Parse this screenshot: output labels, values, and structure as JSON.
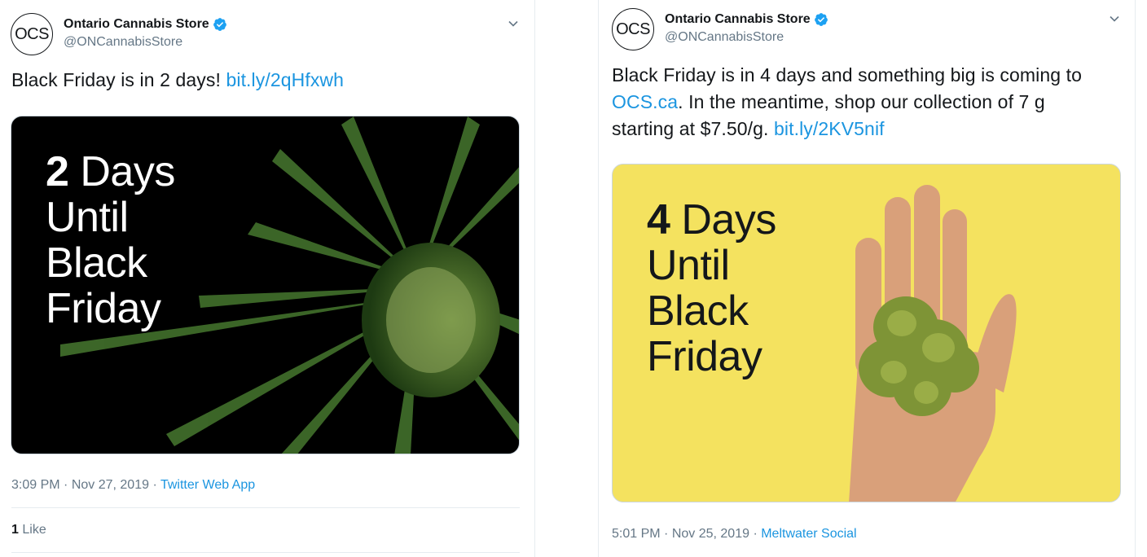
{
  "tweets": [
    {
      "account_name": "Ontario Cannabis Store",
      "handle": "@ONCannabisStore",
      "avatar_text": "OCS",
      "text_plain": "Black Friday is in 2 days! ",
      "link": "bit.ly/2qHfxwh",
      "media": {
        "title_number": "2",
        "title_lines": [
          "Days",
          "Until",
          "Black",
          "Friday"
        ],
        "background": "#000000"
      },
      "time": "3:09 PM",
      "date": "Nov 27, 2019",
      "source": "Twitter Web App",
      "likes_count": "1",
      "likes_label": "Like"
    },
    {
      "account_name": "Ontario Cannabis Store",
      "handle": "@ONCannabisStore",
      "avatar_text": "OCS",
      "text_part1": "Black Friday is in 4 days and something big is coming to",
      "text_link1": "OCS.ca",
      "text_part2": ". In the meantime, shop our collection of 7 g",
      "text_part3": "starting at $7.50/g. ",
      "text_link2": "bit.ly/2KV5nif",
      "media": {
        "title_number": "4",
        "title_lines": [
          "Days",
          "Until",
          "Black",
          "Friday"
        ],
        "background": "#f4e25f"
      },
      "time": "5:01 PM",
      "date": "Nov 25, 2019",
      "source": "Meltwater Social"
    }
  ],
  "colors": {
    "link": "#1b95e0",
    "verified": "#1da1f2",
    "muted": "#657786"
  },
  "separator": " · "
}
